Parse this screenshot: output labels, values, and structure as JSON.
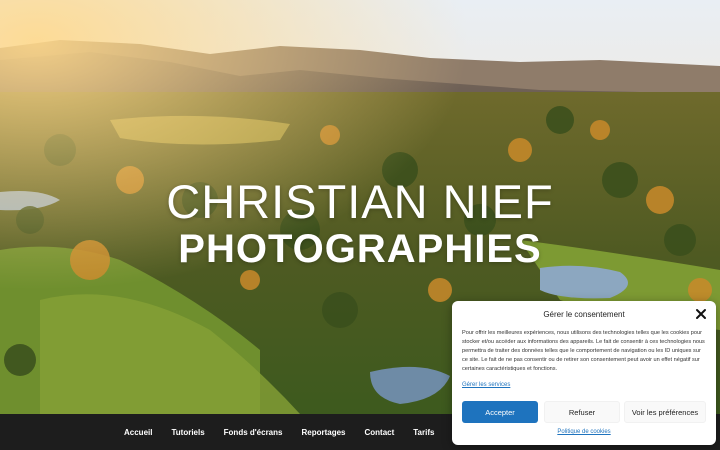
{
  "hero": {
    "brand_line1": "CHRISTIAN NIEF",
    "brand_line2": "PHOTOGRAPHIES"
  },
  "nav": {
    "items": [
      "Accueil",
      "Tutoriels",
      "Fonds d'écrans",
      "Reportages",
      "Contact",
      "Tarifs"
    ]
  },
  "consent": {
    "title": "Gérer le consentement",
    "body": "Pour offrir les meilleures expériences, nous utilisons des technologies telles que les cookies pour stocker et/ou accéder aux informations des appareils. Le fait de consentir à ces technologies nous permettra de traiter des données telles que le comportement de navigation ou les ID uniques sur ce site. Le fait de ne pas consentir ou de retirer son consentement peut avoir un effet négatif sur certaines caractéristiques et fonctions.",
    "services_link": "Gérer les services",
    "accept_label": "Accepter",
    "refuse_label": "Refuser",
    "prefs_label": "Voir les préférences",
    "policy_link": "Politique de cookies",
    "accent_color": "#1e73be"
  },
  "icons": {
    "close": "close-icon"
  }
}
